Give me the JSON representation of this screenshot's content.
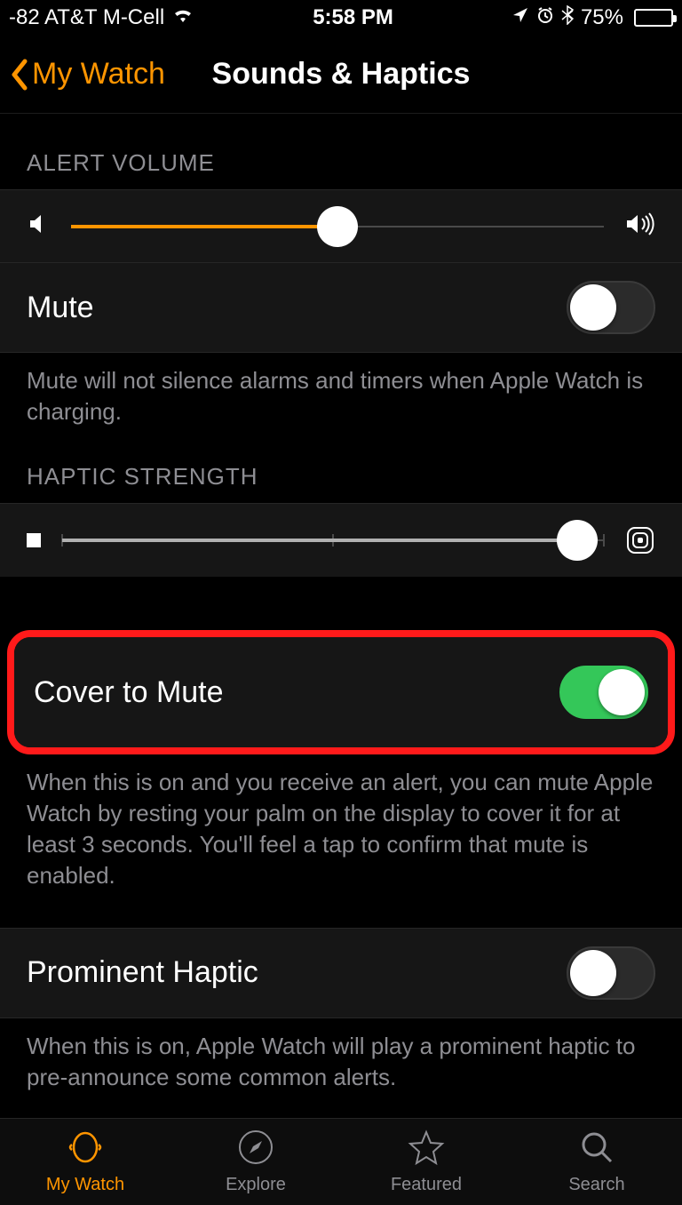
{
  "status": {
    "signal_text": "-82 AT&T M-Cell",
    "time": "5:58 PM",
    "battery_percent": "75%"
  },
  "nav": {
    "back_label": "My Watch",
    "title": "Sounds & Haptics"
  },
  "sections": {
    "alert_volume_header": "ALERT VOLUME",
    "haptic_strength_header": "HAPTIC STRENGTH"
  },
  "rows": {
    "mute_label": "Mute",
    "mute_footer": "Mute will not silence alarms and timers when Apple Watch is charging.",
    "cover_to_mute_label": "Cover to Mute",
    "cover_to_mute_footer": "When this is on and you receive an alert, you can mute Apple Watch by resting your palm on the display to cover it for at least 3 seconds. You'll feel a tap to confirm that mute is enabled.",
    "prominent_haptic_label": "Prominent Haptic",
    "prominent_haptic_footer": "When this is on, Apple Watch will play a prominent haptic to pre-announce some common alerts."
  },
  "sliders": {
    "alert_volume_percent": 50,
    "haptic_strength_percent": 95
  },
  "toggles": {
    "mute": false,
    "cover_to_mute": true,
    "prominent_haptic": false
  },
  "tabs": {
    "my_watch": "My Watch",
    "explore": "Explore",
    "featured": "Featured",
    "search": "Search"
  },
  "colors": {
    "accent": "#ff9500",
    "green": "#34c759",
    "highlight": "#ff1a1a"
  }
}
